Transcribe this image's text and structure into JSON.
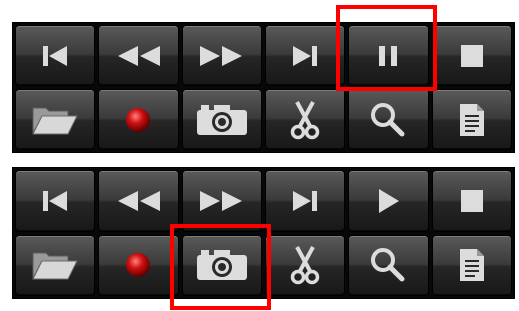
{
  "panels": [
    {
      "row1": [
        "skip-to-start",
        "rewind",
        "fast-forward",
        "skip-to-end",
        "pause",
        "stop"
      ],
      "row2": [
        "open-folder",
        "record",
        "snapshot-camera",
        "scissors-cut",
        "zoom-magnifier",
        "document"
      ],
      "highlighted": "pause"
    },
    {
      "row1": [
        "skip-to-start",
        "rewind",
        "fast-forward",
        "skip-to-end",
        "play",
        "stop"
      ],
      "row2": [
        "open-folder",
        "record",
        "snapshot-camera",
        "scissors-cut",
        "zoom-magnifier",
        "document"
      ],
      "highlighted": "snapshot-camera"
    }
  ],
  "colors": {
    "highlight": "#ff0000",
    "icon": "#dcdcdc",
    "record": "#d01010",
    "button_top": "#5a5a5a",
    "button_bottom": "#181818"
  }
}
